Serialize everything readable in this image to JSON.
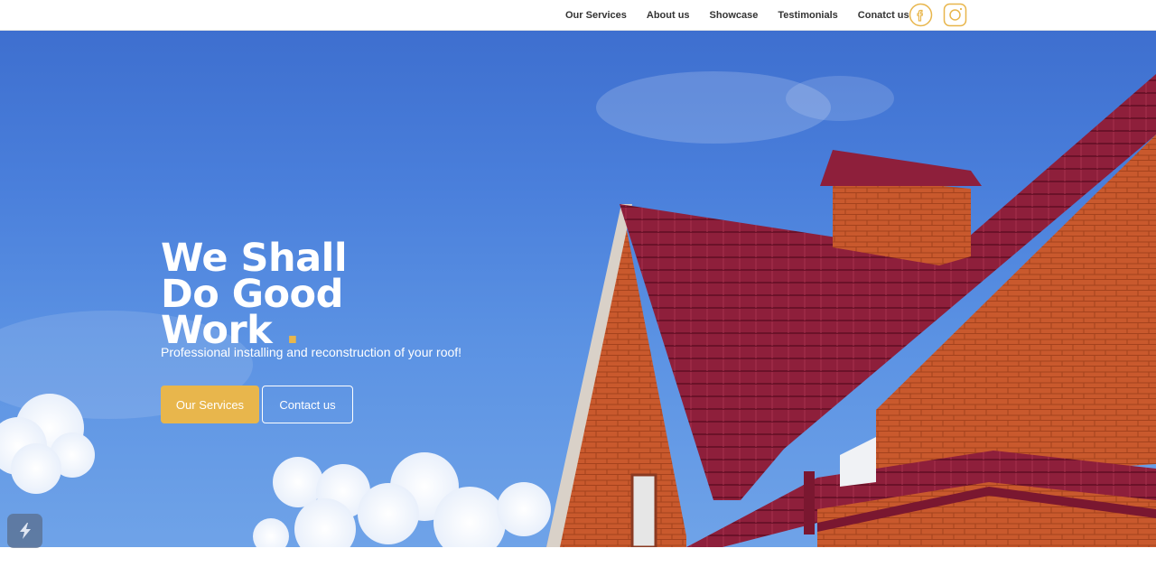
{
  "nav": {
    "links": [
      "Our Services",
      "About us",
      "Showcase",
      "Testimonials",
      "Conatct us"
    ],
    "social": [
      {
        "icon": "facebook-icon"
      },
      {
        "icon": "instagram-icon"
      }
    ]
  },
  "hero": {
    "title_line1": "We Shall",
    "title_line2": "Do Good",
    "title_line3": "Work",
    "title_dot": ".",
    "subtitle": "Professional installing and reconstruction of your roof!",
    "primary_button": "Our Services",
    "secondary_button": "Contact us"
  },
  "colors": {
    "accent": "#e8b64c",
    "roof": "#8e1f3b",
    "brick": "#c4532a",
    "sky": "#4a7fdb"
  }
}
